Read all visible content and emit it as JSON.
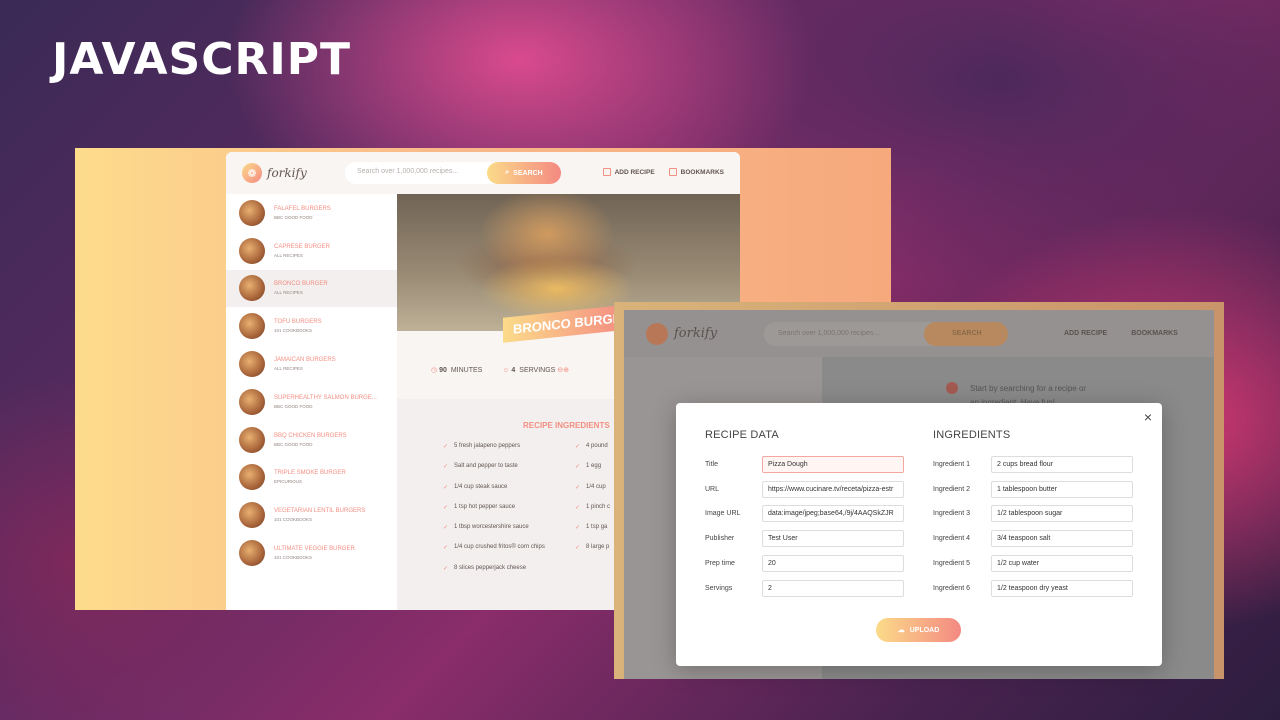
{
  "banner": {
    "title": "JAVASCRIPT"
  },
  "app": {
    "logo": "forkify",
    "search_placeholder": "Search over 1,000,000 recipes...",
    "search_button": "SEARCH",
    "nav_add_recipe": "ADD RECIPE",
    "nav_bookmarks": "BOOKMARKS"
  },
  "results": [
    {
      "name": "FALAFEL BURGERS",
      "publisher": "BBC GOOD FOOD"
    },
    {
      "name": "CAPRESE BURGER",
      "publisher": "ALL RECIPES"
    },
    {
      "name": "BRONCO BURGER",
      "publisher": "ALL RECIPES"
    },
    {
      "name": "TOFU BURGERS",
      "publisher": "101 COOKBOOKS"
    },
    {
      "name": "JAMAICAN BURGERS",
      "publisher": "ALL RECIPES"
    },
    {
      "name": "SUPERHEALTHY SALMON BURGE...",
      "publisher": "BBC GOOD FOOD"
    },
    {
      "name": "BBQ CHICKEN BURGERS",
      "publisher": "BBC GOOD FOOD"
    },
    {
      "name": "TRIPLE SMOKE BURGER",
      "publisher": "EPICURIOUS"
    },
    {
      "name": "VEGETARIAN LENTIL BURGERS",
      "publisher": "101 COOKBOOKS"
    },
    {
      "name": "ULTIMATE VEGGIE BURGER",
      "publisher": "101 COOKBOOKS"
    }
  ],
  "recipe": {
    "title": "BRONCO BURGE",
    "minutes_value": "90",
    "minutes_label": "MINUTES",
    "servings_value": "4",
    "servings_label": "SERVINGS",
    "ingredients_title": "RECIPE INGREDIENTS",
    "ingredients_left": [
      "5 fresh jalapeno peppers",
      "Salt and pepper to taste",
      "1/4 cup steak sauce",
      "1 tsp hot pepper sauce",
      "1 tbsp worcestershire sauce",
      "1/4 cup crushed fritos® corn chips",
      "8 slices pepperjack cheese"
    ],
    "ingredients_right": [
      "4 pound",
      "1 egg",
      "1/4 cup",
      "1 pinch c",
      "1 tsp ga",
      "8 large p"
    ]
  },
  "dim_app": {
    "logo": "forkify",
    "search_placeholder": "Search over 1,000,000 recipes...",
    "search_button": "SEARCH",
    "nav_add_recipe": "ADD RECIPE",
    "nav_bookmarks": "BOOKMARKS",
    "message_line1": "Start by searching for a recipe or",
    "message_line2": "an ingredient. Have fun!"
  },
  "modal": {
    "recipe_heading": "RECIPE DATA",
    "ingredients_heading": "INGREDIENTS",
    "close": "×",
    "upload": "UPLOAD",
    "fields": [
      {
        "label": "Title",
        "value": "Pizza Dough"
      },
      {
        "label": "URL",
        "value": "https://www.cucinare.tv/receta/pizza-estr"
      },
      {
        "label": "Image URL",
        "value": "data:image/jpeg;base64,/9j/4AAQSkZJR"
      },
      {
        "label": "Publisher",
        "value": "Test User"
      },
      {
        "label": "Prep time",
        "value": "20"
      },
      {
        "label": "Servings",
        "value": "2"
      }
    ],
    "ingredients": [
      {
        "label": "Ingredient 1",
        "value": "2 cups bread flour"
      },
      {
        "label": "Ingredient 2",
        "value": "1 tablespoon butter"
      },
      {
        "label": "Ingredient 3",
        "value": "1/2 tablespoon sugar"
      },
      {
        "label": "Ingredient 4",
        "value": "3/4 teaspoon salt"
      },
      {
        "label": "Ingredient 5",
        "value": "1/2 cup water"
      },
      {
        "label": "Ingredient 6",
        "value": "1/2 teaspoon dry yeast"
      }
    ]
  }
}
